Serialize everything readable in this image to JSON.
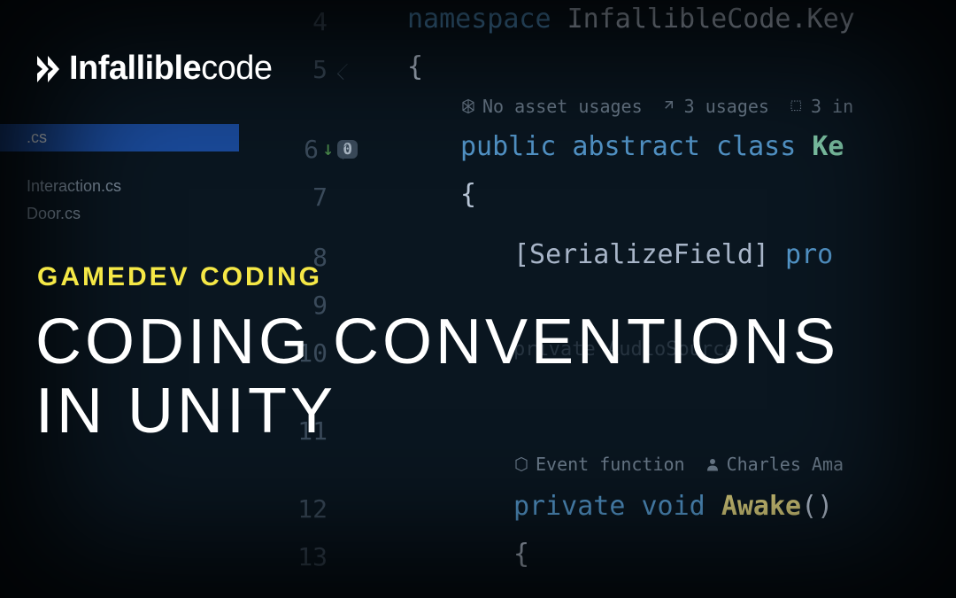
{
  "logo": {
    "bold": "Infallible",
    "light": "code"
  },
  "subtitle": "GAMEDEV CODING",
  "title_line1": "CODING CONVENTIONS",
  "title_line2": "IN UNITY",
  "sidebar": {
    "files": [
      {
        "name": ".cs",
        "selected": true
      },
      {
        "name": "Interaction.cs",
        "selected": false
      },
      {
        "name": "Door.cs",
        "selected": false
      }
    ]
  },
  "gutter": {
    "lines": [
      "4",
      "5",
      "6",
      "7",
      "8",
      "9",
      "10",
      "11",
      "12",
      "13"
    ],
    "line6_marker": {
      "arrow": "↓",
      "badge": "0"
    }
  },
  "code": {
    "l4": {
      "kw": "namespace",
      "rest": " InfallibleCode.Key"
    },
    "l5": "{",
    "hints1": {
      "a": "No asset usages",
      "b": "3 usages",
      "c": "3 in"
    },
    "l6": {
      "kw": "public abstract class ",
      "type": "Ke"
    },
    "l7": "{",
    "l8": {
      "attr": "[SerializeField] ",
      "kw": "pro"
    },
    "l10_a": "private ",
    "l10_b": "AudioSource",
    "hints2": {
      "a": "Event function",
      "b": "Charles Ama"
    },
    "l12": {
      "kw": "private void ",
      "fn": "Awake",
      "rest": "()"
    },
    "l13": "{"
  }
}
